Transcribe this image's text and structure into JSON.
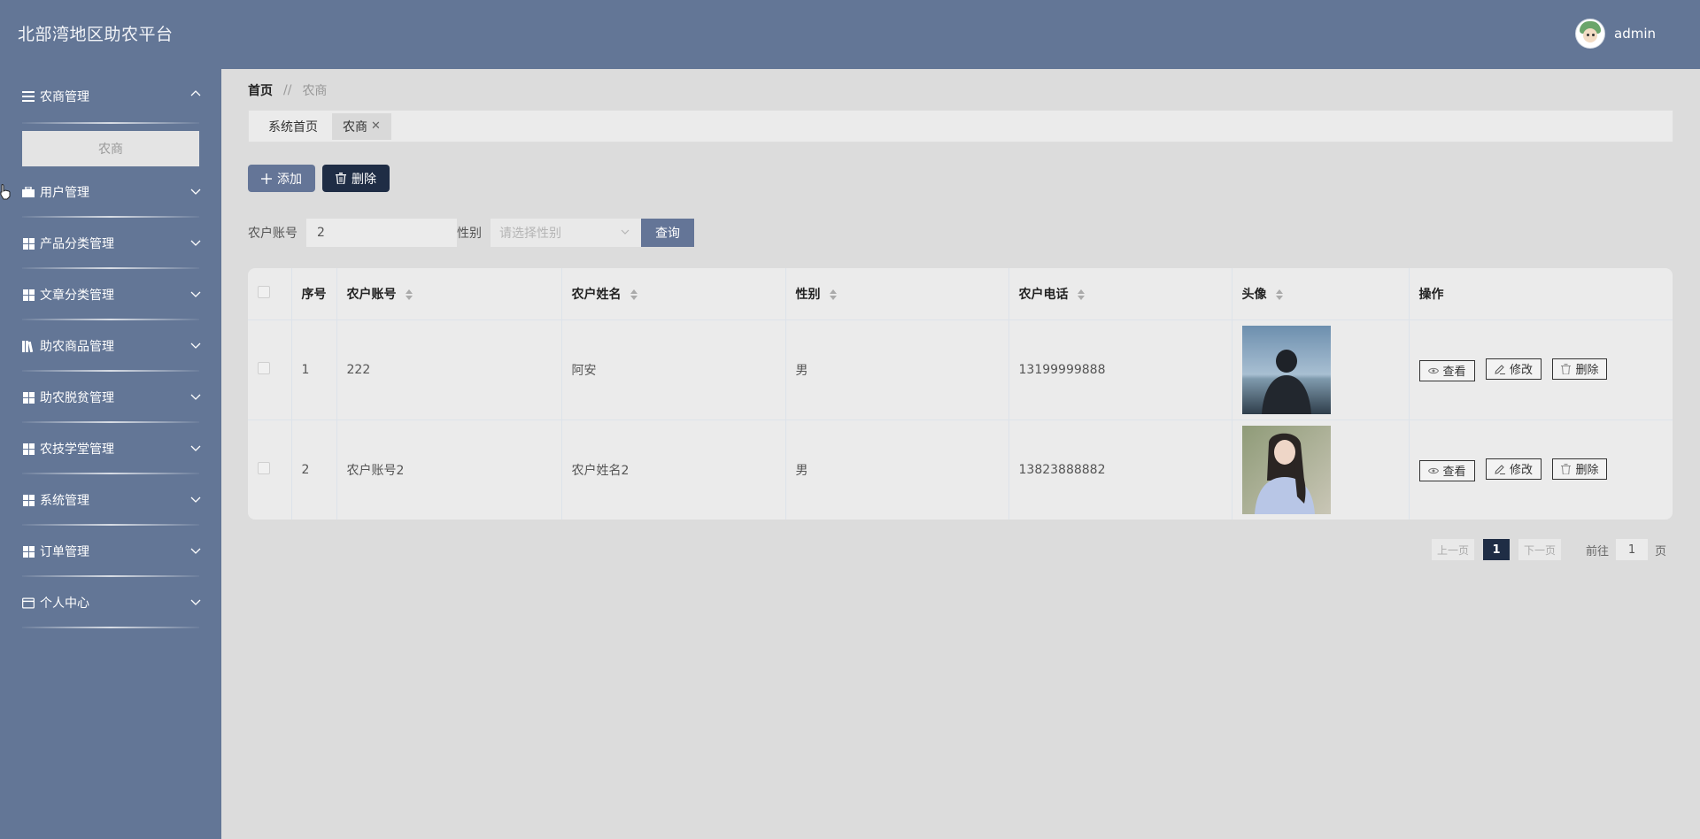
{
  "header": {
    "title": "北部湾地区助农平台",
    "username": "admin"
  },
  "sidebar": {
    "items": [
      {
        "label": "农商管理",
        "icon": "list-icon",
        "expanded": true,
        "children": [
          "农商"
        ]
      },
      {
        "label": "用户管理",
        "icon": "briefcase-icon"
      },
      {
        "label": "产品分类管理",
        "icon": "grid-icon"
      },
      {
        "label": "文章分类管理",
        "icon": "grid-icon"
      },
      {
        "label": "助农商品管理",
        "icon": "books-icon"
      },
      {
        "label": "助农脱贫管理",
        "icon": "grid-icon"
      },
      {
        "label": "农技学堂管理",
        "icon": "grid-icon"
      },
      {
        "label": "系统管理",
        "icon": "grid-icon"
      },
      {
        "label": "订单管理",
        "icon": "grid-icon"
      },
      {
        "label": "个人中心",
        "icon": "card-icon"
      }
    ]
  },
  "breadcrumb": {
    "home": "首页",
    "separator": "//",
    "current": "农商"
  },
  "tabs": [
    {
      "label": "系统首页"
    },
    {
      "label": "农商",
      "close": "✕"
    }
  ],
  "toolbar": {
    "add_label": "添加",
    "delete_label": "删除"
  },
  "search": {
    "account_label": "农户账号",
    "account_value": "2",
    "gender_label": "性别",
    "gender_placeholder": "请选择性别",
    "query_label": "查询"
  },
  "table": {
    "headers": [
      "序号",
      "农户账号",
      "农户姓名",
      "性别",
      "农户电话",
      "头像",
      "操作"
    ],
    "rows": [
      {
        "index": "1",
        "account": "222",
        "name": "阿安",
        "gender": "男",
        "phone": "13199999888"
      },
      {
        "index": "2",
        "account": "农户账号2",
        "name": "农户姓名2",
        "gender": "男",
        "phone": "13823888882"
      }
    ],
    "actions": {
      "view": "查看",
      "edit": "修改",
      "delete": "删除"
    }
  },
  "pagination": {
    "prev": "上一页",
    "current": "1",
    "next": "下一页",
    "goto_label": "前往",
    "goto_value": "1",
    "suffix": "页"
  },
  "colors": {
    "primary": "#637696",
    "dark": "#1f2d45",
    "background": "#dcdcdc"
  }
}
